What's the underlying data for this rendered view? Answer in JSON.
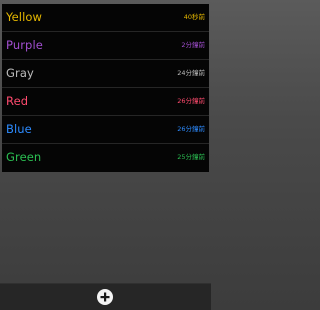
{
  "timers": [
    {
      "name": "Yellow",
      "time": "40秒前",
      "color": "#e6b800"
    },
    {
      "name": "Purple",
      "time": "2分鐘前",
      "color": "#a24fd1"
    },
    {
      "name": "Gray",
      "time": "24分鐘前",
      "color": "#bdbdbd"
    },
    {
      "name": "Red",
      "time": "26分鐘前",
      "color": "#ff4b6e"
    },
    {
      "name": "Blue",
      "time": "26分鐘前",
      "color": "#2d8bff"
    },
    {
      "name": "Green",
      "time": "25分鐘前",
      "color": "#2bbf52"
    }
  ],
  "footer": {
    "add_icon": "plus-circle-icon"
  }
}
